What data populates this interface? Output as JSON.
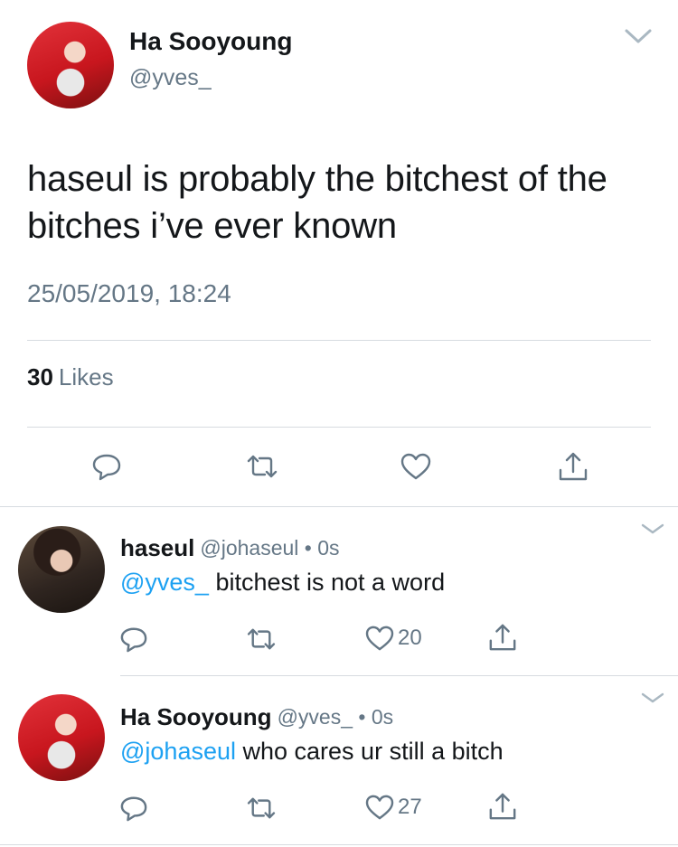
{
  "tweet": {
    "author_name": "Ha Sooyoung",
    "author_handle": "@yves_",
    "text": "haseul is probably the bitchest of the bitches i’ve ever known",
    "timestamp": "25/05/2019, 18:24",
    "likes_count": "30",
    "likes_label": "Likes"
  },
  "replies": [
    {
      "name": "haseul",
      "meta": "@johaseul • 0s",
      "mention": "@yves_",
      "text": " bitchest is not a word",
      "like_count": "20"
    },
    {
      "name": "Ha Sooyoung",
      "meta": "@yves_ • 0s",
      "mention": "@johaseul",
      "text": " who cares ur still a bitch",
      "like_count": "27"
    }
  ],
  "icons": {
    "reply": "reply-icon",
    "retweet": "retweet-icon",
    "like": "heart-icon",
    "share": "share-icon",
    "menu": "chevron-down-icon"
  },
  "colors": {
    "text": "#14171a",
    "muted": "#657786",
    "link": "#1da1f2",
    "divider": "#d7dbe0"
  }
}
